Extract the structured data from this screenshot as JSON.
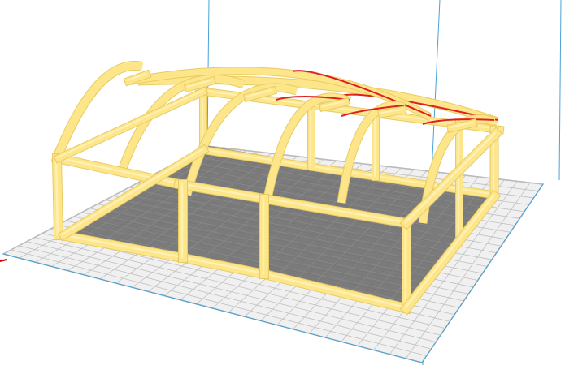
{
  "viewport": {
    "background_color": "#ffffff",
    "build_plate": {
      "plate_color": "#f0f0f0",
      "grid_line_color": "#c0c0c0",
      "border_color": "#aaaaaa",
      "shadow_color": "#6e6e6e"
    },
    "build_volume": {
      "outline_color": "#4aa3d8"
    },
    "axis_origin_color": "#cc0000",
    "model": {
      "fill_color": "#fde58a",
      "highlight_color": "#fff1b3",
      "shade_color": "#e8cb62",
      "overhang_color": "#e02020"
    }
  }
}
